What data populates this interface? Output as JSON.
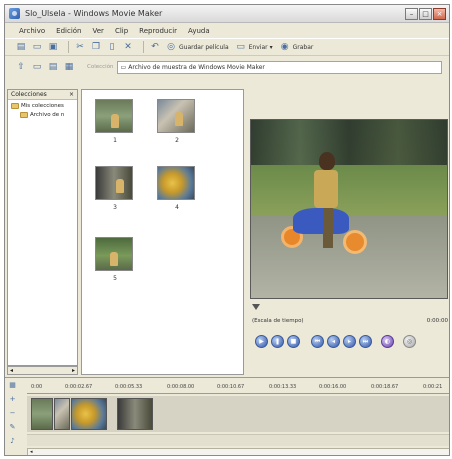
{
  "window": {
    "title": "Slo_Ulsela - Windows Movie Maker",
    "buttons": {
      "minimize": "–",
      "maximize": "□",
      "close": "×"
    }
  },
  "menu": [
    "Archivo",
    "Edición",
    "Ver",
    "Clip",
    "Reproducir",
    "Ayuda"
  ],
  "toolbar": {
    "save_movie": "Guardar película",
    "send": "Enviar",
    "record": "Grabar"
  },
  "address": {
    "label": "Colección",
    "value": "Archivo de muestra de Windows Movie Maker"
  },
  "collections": {
    "header": "Colecciones",
    "close": "×",
    "items": [
      {
        "label": "Mis colecciones"
      },
      {
        "label": "Archivo de n"
      }
    ]
  },
  "clips": [
    {
      "label": "1"
    },
    {
      "label": "2"
    },
    {
      "label": "3"
    },
    {
      "label": "4"
    },
    {
      "label": "5"
    }
  ],
  "preview": {
    "timescale_label": "(Escala de tiempo)",
    "time": "0:00:00"
  },
  "timeline": {
    "ticks": [
      "0:00",
      "0:00:02.67",
      "0:00:05.33",
      "0:00:08.00",
      "0:00:10.67",
      "0:00:13.33",
      "0:00:16.00",
      "0:00:18.67",
      "0:00:21"
    ]
  },
  "icons": {
    "new": "new-document-icon",
    "open": "open-folder-icon",
    "save": "save-icon",
    "cut": "cut-icon",
    "copy": "copy-icon",
    "paste": "paste-icon",
    "delete": "delete-icon"
  }
}
